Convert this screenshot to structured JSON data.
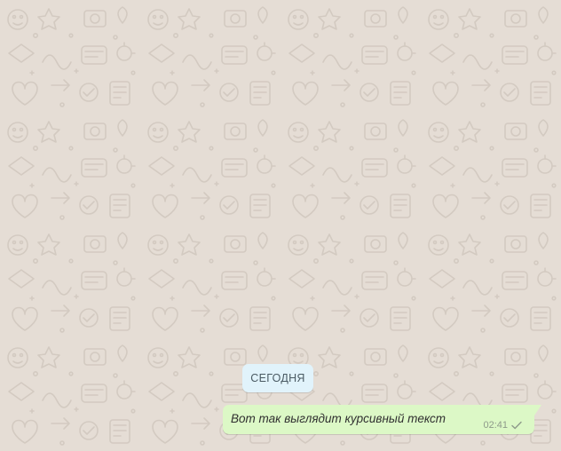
{
  "chat": {
    "date_separator": "СЕГОДНЯ",
    "messages": [
      {
        "text": "Вот так выглядит курсивный текст",
        "time": "02:41",
        "status_icon": "single-check-icon",
        "direction": "outgoing"
      }
    ]
  },
  "theme": {
    "wallpaper_color": "#e5ddd5",
    "doodle_color": "#cfc6bd",
    "date_chip_bg": "#e1f3fb",
    "outgoing_bubble_bg": "#dcf8c6"
  }
}
